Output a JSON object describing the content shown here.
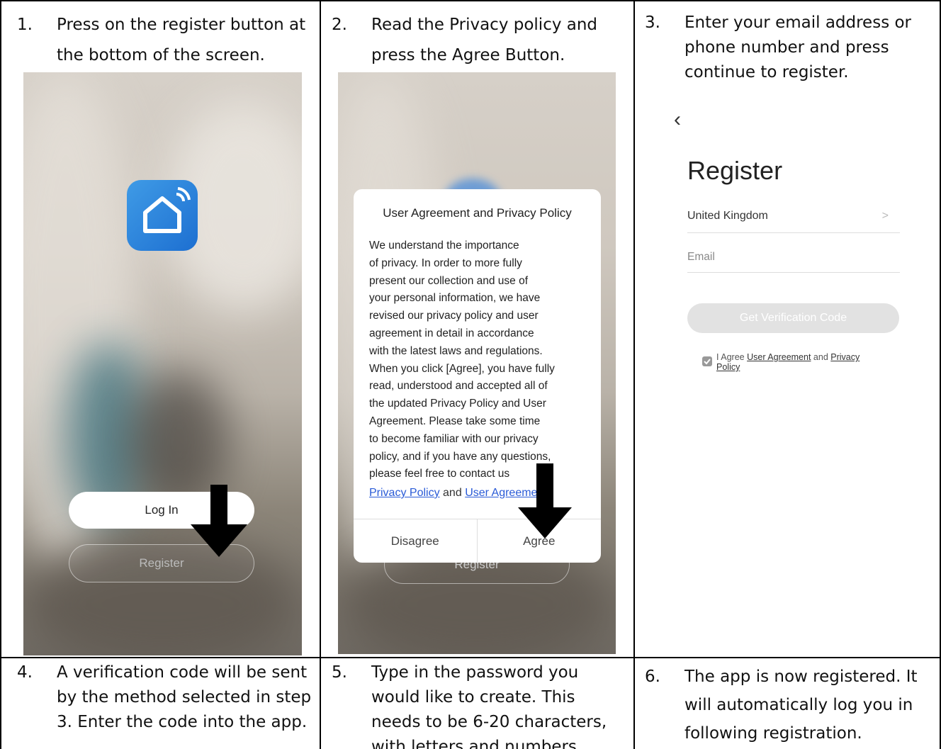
{
  "steps": [
    {
      "num": "1.",
      "lines": [
        "Press on the register button at",
        "the bottom of the screen."
      ]
    },
    {
      "num": "2.",
      "lines": [
        "Read the Privacy policy and",
        "press the Agree Button."
      ]
    },
    {
      "num": "3.",
      "lines": [
        "Enter your email address or",
        "phone number and press",
        "continue to register."
      ]
    },
    {
      "num": "4.",
      "lines": [
        "A verification code will be sent",
        "by the method selected in step",
        "3. Enter the code into the app."
      ]
    },
    {
      "num": "5.",
      "lines": [
        "Type in the password you",
        "would like to create. This",
        "needs to be 6-20 characters,",
        "with letters and numbers"
      ]
    },
    {
      "num": "6.",
      "lines": [
        "The app is now registered. It",
        "will automatically log you in",
        "following registration."
      ]
    }
  ],
  "screen1": {
    "login_label": "Log In",
    "register_label": "Register"
  },
  "screen2": {
    "modal_title": "User Agreement and Privacy Policy",
    "body_lines": [
      "We understand the importance",
      "of privacy. In order to more fully",
      "present our collection and use of",
      "your personal information, we have",
      "revised our privacy policy and user",
      "agreement in detail in accordance",
      "with the latest laws and regulations.",
      "When you click [Agree], you have fully",
      "read, understood and accepted all of",
      "the updated Privacy Policy and User",
      "Agreement. Please take some time",
      "to become familiar with our privacy",
      "policy, and if you have any questions,",
      "please feel free to contact us"
    ],
    "link_privacy": "Privacy Policy",
    "link_and": "and",
    "link_user": "User Agreement",
    "disagree_label": "Disagree",
    "agree_label": "Agree",
    "register_label": "Register"
  },
  "screen3": {
    "back_glyph": "‹",
    "title": "Register",
    "country": "United Kingdom",
    "chevron": ">",
    "email_placeholder": "Email",
    "button_label": "Get Verification Code",
    "agree_text": "I Agree",
    "user_agreement": "User Agreement",
    "and": "and",
    "privacy": "Privacy",
    "policy": "Policy"
  },
  "colors": {
    "accent_blue": "#2a7de1",
    "link_blue": "#2a5bd7",
    "border": "#000000"
  }
}
